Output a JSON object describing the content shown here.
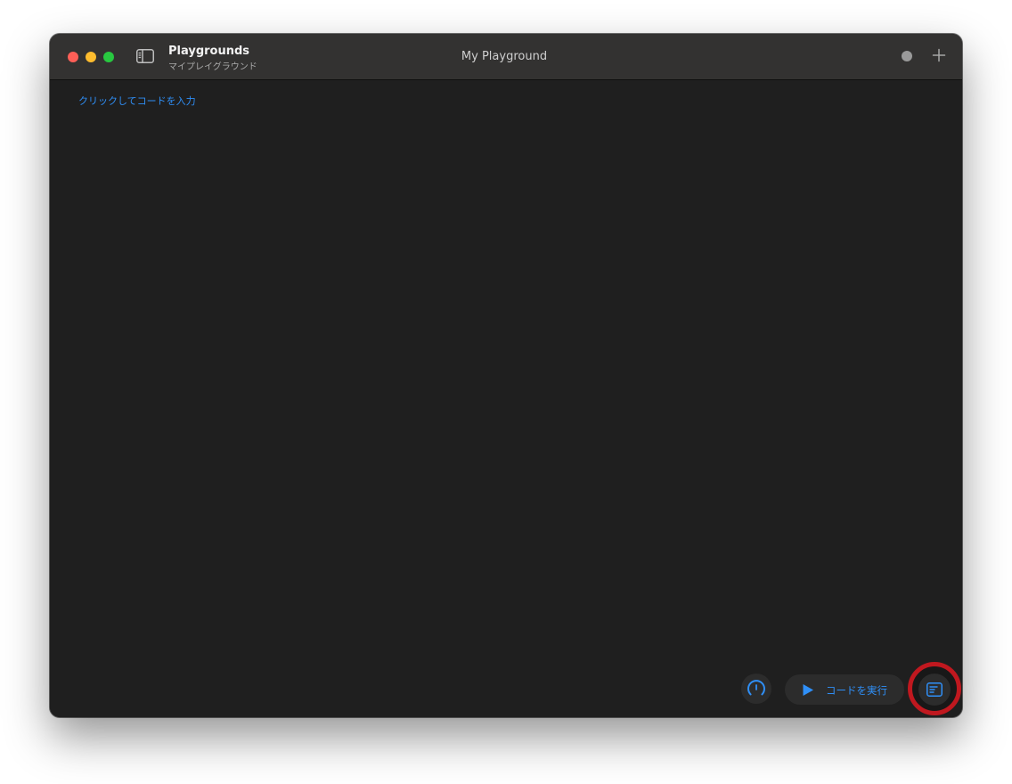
{
  "window": {
    "app_title": "Playgrounds",
    "app_subtitle": "マイプレイグラウンド",
    "document_title": "My Playground",
    "icons": {
      "close": "close-icon",
      "minimize": "minimize-icon",
      "zoom": "zoom-icon",
      "sidebar_toggle": "sidebar-toggle-icon",
      "status": "status-dot-icon",
      "add": "plus-icon"
    }
  },
  "editor": {
    "placeholder": "クリックしてコードを入力"
  },
  "bottom_bar": {
    "gauge_icon": "gauge-icon",
    "run_label": "コードを実行",
    "run_icon": "play-icon",
    "console_icon": "console-icon"
  },
  "colors": {
    "accent": "#2f8ff7",
    "highlight": "#c0181f",
    "titlebar": "#333231",
    "editor_background": "#1f1f1f"
  }
}
